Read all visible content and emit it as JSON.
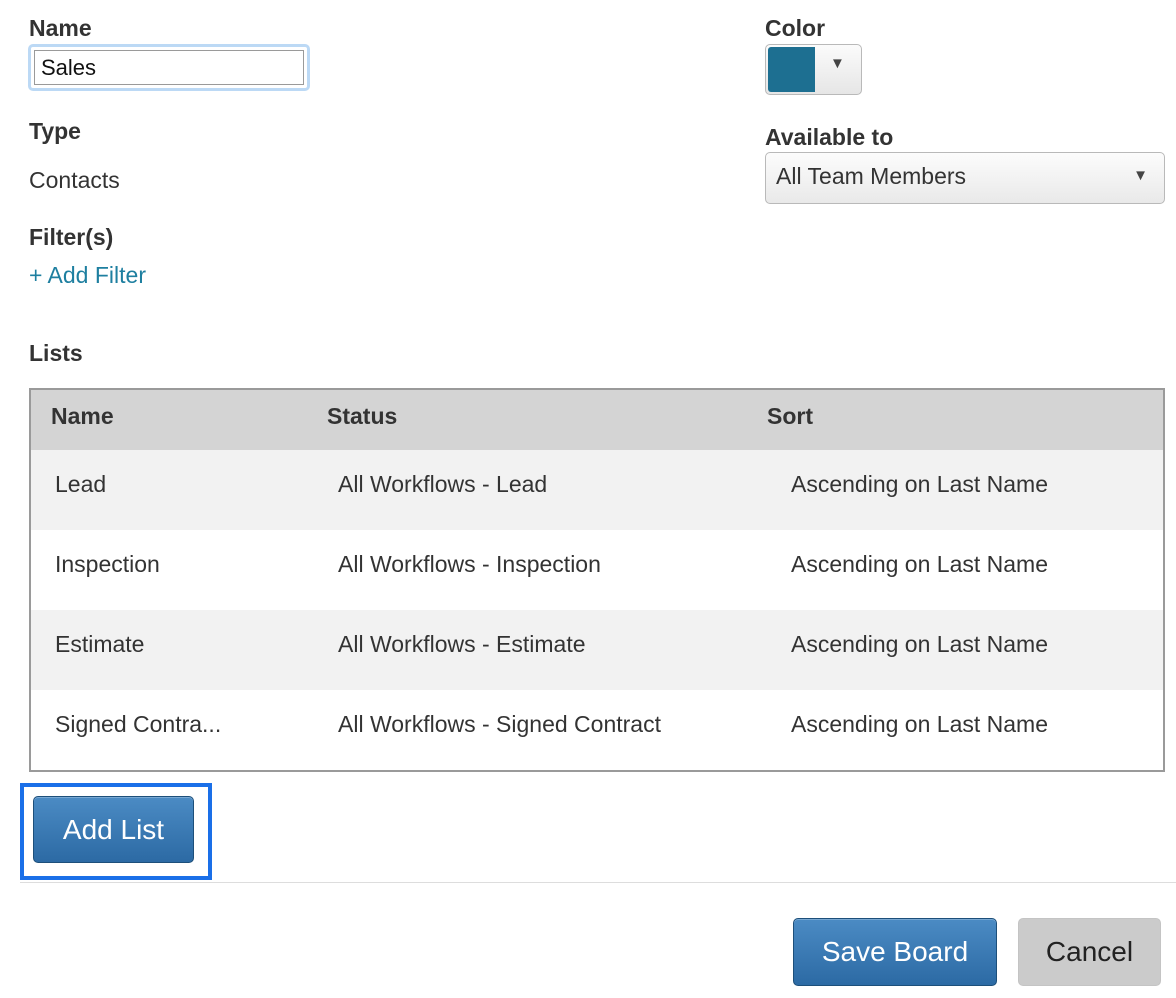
{
  "form": {
    "name_label": "Name",
    "name_value": "Sales",
    "type_label": "Type",
    "type_value": "Contacts",
    "filters_label": "Filter(s)",
    "add_filter_label": "+ Add Filter",
    "lists_label": "Lists",
    "color_label": "Color",
    "color_value": "#1d6f91",
    "color_arrow_icon": "triangle-down-icon",
    "available_label": "Available to",
    "available_value": "All Team Members",
    "available_arrow_icon": "triangle-down-icon"
  },
  "table": {
    "headers": [
      "Name",
      "Status",
      "Sort"
    ],
    "rows": [
      {
        "name": "Lead",
        "status": "All Workflows - Lead",
        "sort": "Ascending on Last Name"
      },
      {
        "name": "Inspection",
        "status": "All Workflows - Inspection",
        "sort": "Ascending on Last Name"
      },
      {
        "name": "Estimate",
        "status": "All Workflows - Estimate",
        "sort": "Ascending on Last Name"
      },
      {
        "name": "Signed Contra...",
        "status": "All Workflows - Signed Contract",
        "sort": "Ascending on Last Name"
      }
    ]
  },
  "buttons": {
    "add_list": "Add List",
    "save_board": "Save Board",
    "cancel": "Cancel"
  },
  "colors": {
    "primary_button": "#3474ae",
    "link": "#1e7fa0",
    "focus_ring": "#1a6fe8"
  }
}
